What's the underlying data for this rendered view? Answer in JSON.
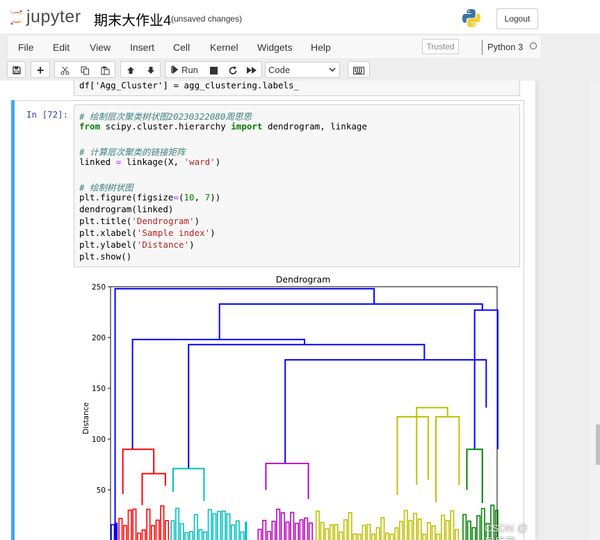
{
  "header": {
    "logo_text": "jupyter",
    "notebook_name": "期末大作业4",
    "autosave_status": "(unsaved changes)",
    "logout_label": "Logout"
  },
  "menubar": {
    "items": [
      "File",
      "Edit",
      "View",
      "Insert",
      "Cell",
      "Kernel",
      "Widgets",
      "Help"
    ],
    "trusted_label": "Trusted",
    "kernel_name": "Python 3"
  },
  "toolbar": {
    "run_label": "Run",
    "cell_type": "Code",
    "icons": [
      "save-icon",
      "plus-icon",
      "cut-icon",
      "copy-icon",
      "paste-icon",
      "arrow-up-icon",
      "arrow-down-icon",
      "run-icon",
      "stop-icon",
      "restart-icon",
      "fast-forward-icon",
      "keyboard-icon"
    ]
  },
  "prev_cell": {
    "code_line": "df['Agg_Cluster'] = agg_clustering.labels_"
  },
  "cell": {
    "prompt": "In  [72]:",
    "lines": [
      "# 绘制层次聚类树状图20230322080周思思",
      "from scipy.cluster.hierarchy import dendrogram, linkage",
      "",
      "# 计算层次聚类的链接矩阵",
      "linked = linkage(X, 'ward')",
      "",
      "# 绘制树状图",
      "plt.figure(figsize=(10, 7))",
      "dendrogram(linked)",
      "plt.title('Dendrogram')",
      "plt.xlabel('Sample index')",
      "plt.ylabel('Distance')",
      "plt.show()"
    ]
  },
  "colors": {
    "accent": "#42a5f5",
    "blue": "#0000ff",
    "red": "#ff0000",
    "cyan": "#00bfbf",
    "magenta": "#bf00bf",
    "olive": "#bfbf00",
    "green": "#008000"
  },
  "chart_data": {
    "type": "dendrogram",
    "title": "Dendrogram",
    "ylabel": "Distance",
    "xlabel": "",
    "y_ticks": [
      50,
      100,
      150,
      200,
      250
    ],
    "ylim": [
      0,
      260
    ],
    "links": [
      {
        "x": [
          1,
          1,
          68,
          68
        ],
        "y": [
          0,
          248,
          248,
          233
        ],
        "color": "blue"
      },
      {
        "x": [
          28,
          28,
          96,
          96
        ],
        "y": [
          198,
          233,
          233,
          227
        ],
        "color": "blue"
      },
      {
        "x": [
          5.5,
          5.5,
          50,
          50
        ],
        "y": [
          90,
          198,
          198,
          193
        ],
        "color": "blue"
      },
      {
        "x": [
          20,
          20,
          81,
          81
        ],
        "y": [
          71,
          193,
          193,
          178
        ],
        "color": "blue"
      },
      {
        "x": [
          45,
          45,
          97,
          97
        ],
        "y": [
          76,
          178,
          178,
          131
        ],
        "color": "blue"
      },
      {
        "x": [
          94,
          94,
          100,
          100
        ],
        "y": [
          90,
          227,
          227,
          90
        ],
        "color": "blue"
      },
      {
        "x": [
          3,
          3,
          11,
          11
        ],
        "y": [
          46,
          90,
          90,
          66
        ],
        "color": "red"
      },
      {
        "x": [
          8,
          8,
          14,
          14
        ],
        "y": [
          35,
          66,
          66,
          54
        ],
        "color": "red"
      },
      {
        "x": [
          16,
          16,
          24,
          24
        ],
        "y": [
          48,
          71,
          71,
          39
        ],
        "color": "cyan"
      },
      {
        "x": [
          40,
          40,
          51,
          51
        ],
        "y": [
          50,
          76,
          76,
          41
        ],
        "color": "magenta"
      },
      {
        "x": [
          79,
          79,
          87,
          87
        ],
        "y": [
          55,
          131,
          131,
          122
        ],
        "color": "olive"
      },
      {
        "x": [
          74,
          74,
          82,
          82
        ],
        "y": [
          45,
          122,
          122,
          60
        ],
        "color": "olive"
      },
      {
        "x": [
          84,
          84,
          90,
          90
        ],
        "y": [
          38,
          122,
          122,
          55
        ],
        "color": "olive"
      },
      {
        "x": [
          92,
          92,
          96,
          96
        ],
        "y": [
          50,
          90,
          90,
          37
        ],
        "color": "green"
      }
    ]
  }
}
